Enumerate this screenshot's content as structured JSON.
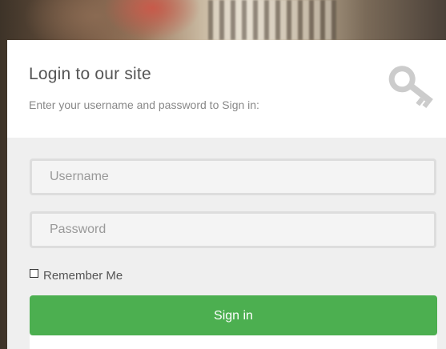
{
  "login": {
    "title": "Login to our site",
    "subtitle": "Enter your username and password to Sign in:",
    "username_placeholder": "Username",
    "password_placeholder": "Password",
    "remember_label": "Remember Me",
    "remember_checked": false,
    "signin_label": "Sign in",
    "key_icon": "key-icon"
  },
  "colors": {
    "button": "#4caf50",
    "form_bg": "#efefef",
    "header_bg": "#ffffff"
  }
}
